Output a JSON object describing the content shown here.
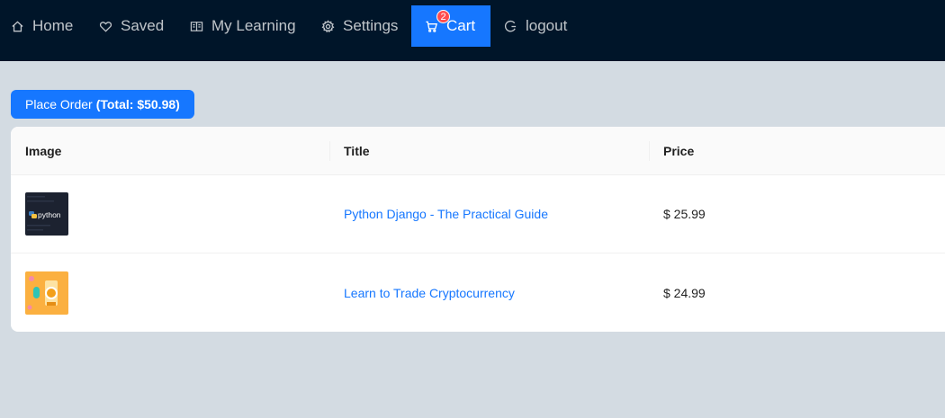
{
  "nav": {
    "home": "Home",
    "saved": "Saved",
    "learning": "My Learning",
    "settings": "Settings",
    "cart": "Cart",
    "cart_count": "2",
    "logout": "logout"
  },
  "order": {
    "label": "Place Order",
    "total": "(Total: $50.98)"
  },
  "table": {
    "headers": [
      "Image",
      "Title",
      "Price"
    ],
    "rows": [
      {
        "image_text": "python",
        "title": "Python Django - The Practical Guide",
        "price": "$ 25.99"
      },
      {
        "title": "Learn to Trade Cryptocurrency",
        "price": "$ 24.99"
      }
    ]
  },
  "colors": {
    "nav_bg": "#001529",
    "accent": "#1677ff",
    "badge": "#ff4d4f",
    "page_bg": "#d3dbe2"
  }
}
